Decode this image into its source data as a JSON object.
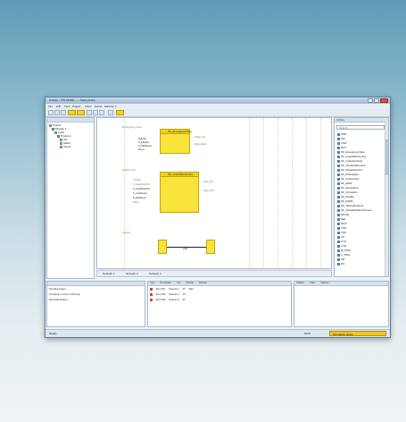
{
  "window": {
    "title": "Untitled – PSI MODE ... – Safety Editor",
    "menu": [
      "File",
      "Edit",
      "View",
      "Project",
      "Insert",
      "Extras",
      "Window",
      "?"
    ]
  },
  "toolbar": {
    "buttons": [
      "new",
      "open",
      "save",
      "cut",
      "copy",
      "paste",
      "undo",
      "redo",
      "highlight-a",
      "highlight-b",
      "zoom"
    ]
  },
  "tree": {
    "nodes": [
      "Project",
      "Module 1",
      "Logic",
      "Program",
      "Var",
      "Safety",
      "Inputs"
    ]
  },
  "canvas": {
    "block1": {
      "caption": "Emergency stop",
      "title": "SF_EmergencyStop",
      "inputs_left": [
        "Activate",
        "S_EStopIn",
        "S_StartReset",
        "Reset"
      ],
      "outputs_right": [
        "Ready",
        "S_EStopOut",
        "Error",
        "DiagCode"
      ],
      "out_labels": [
        "→ EStop_OK",
        "→ Diag_EStop"
      ]
    },
    "block2": {
      "caption": "Safety door",
      "title": "SF_GuardMonitoring",
      "inputs_left": [
        "Activate",
        "S_GuardSwitch1",
        "S_GuardSwitch2",
        "S_GuardLock",
        "S_StartReset",
        "Reset"
      ],
      "outputs_right": [
        "Ready",
        "S_GuardMonitoring",
        "Error",
        "DiagCode"
      ],
      "out_labels": [
        "→ Door_OK",
        "→ Diag_Door"
      ]
    },
    "block3": {
      "caption": "Output",
      "and_label": "AND"
    },
    "tabs": [
      "Network 1",
      "Network 2",
      "Network 3"
    ]
  },
  "library": {
    "header": "Library",
    "search_placeholder": "Search",
    "items": [
      "AND",
      "OR",
      "XOR",
      "NOT",
      "SF_EmergencyStop",
      "SF_GuardMonitoring",
      "SF_GuardLocking",
      "SF_TwoHandControl",
      "SF_ModeSelector",
      "SF_MutingSeq",
      "SF_OutControl",
      "SF_EDM",
      "SF_Equivalent",
      "SF_Antivalent",
      "SF_Enable",
      "SF_ESPE",
      "SF_SafetyRequest",
      "SF_TestableSafetySensor",
      "MOVE",
      "SEL",
      "MUX",
      "TON",
      "TOF",
      "TP",
      "CTU",
      "CTD",
      "R_TRIG",
      "F_TRIG",
      "SR",
      "RS"
    ]
  },
  "messages": {
    "lines": [
      "Checking project...",
      "Compiling: 0 errors, 0 warnings",
      "Download finished"
    ]
  },
  "errors": {
    "columns": [
      "Type",
      "Description",
      "Line",
      "Module",
      "Network"
    ],
    "rows": [
      [
        "!",
        "Error 001",
        "Network 1",
        "12",
        "Safe"
      ],
      [
        "!",
        "Error 002",
        "Network 2",
        "18",
        ""
      ],
      [
        "!",
        "Error 003",
        "Network 3",
        "22",
        ""
      ]
    ]
  },
  "watch": {
    "columns": [
      "Variable",
      "Value",
      "Address"
    ]
  },
  "status": {
    "left": "Ready",
    "mid": "NUM",
    "right": "Simulation active"
  },
  "colors": {
    "block_fill": "#f8e43a",
    "net_green": "#4e9a3c",
    "window_frame": "#5d7f9c"
  }
}
